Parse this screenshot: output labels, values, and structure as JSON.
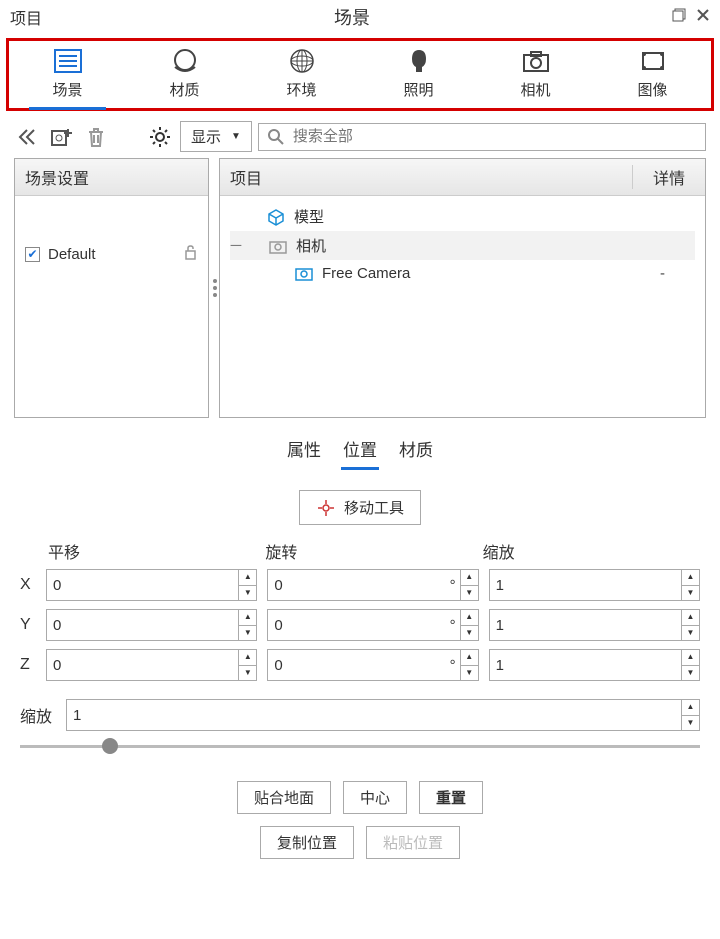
{
  "titlebar": {
    "project": "项目",
    "title": "场景"
  },
  "tabs": [
    {
      "label": "场景"
    },
    {
      "label": "材质"
    },
    {
      "label": "环境"
    },
    {
      "label": "照明"
    },
    {
      "label": "相机"
    },
    {
      "label": "图像"
    }
  ],
  "toolbar": {
    "dropdown": "显示",
    "search_placeholder": "搜索全部"
  },
  "leftPanel": {
    "title": "场景设置",
    "default": "Default"
  },
  "rightPanel": {
    "col1": "项目",
    "col2": "详情",
    "items": {
      "model": "模型",
      "camera": "相机",
      "freeCam": "Free Camera",
      "dash": "-"
    }
  },
  "subtabs": {
    "attr": "属性",
    "pos": "位置",
    "mat": "材质"
  },
  "moveTool": "移动工具",
  "xform": {
    "translate": "平移",
    "rotate": "旋转",
    "scale": "缩放",
    "x": {
      "t": "0",
      "r": "0",
      "s": "1"
    },
    "y": {
      "t": "0",
      "r": "0",
      "s": "1"
    },
    "z": {
      "t": "0",
      "r": "0",
      "s": "1"
    },
    "labels": {
      "x": "X",
      "y": "Y",
      "z": "Z"
    },
    "degree": "°"
  },
  "scaleRow": {
    "label": "缩放",
    "value": "1"
  },
  "buttons": {
    "snap": "贴合地面",
    "center": "中心",
    "reset": "重置",
    "copy": "复制位置",
    "paste": "粘贴位置"
  }
}
